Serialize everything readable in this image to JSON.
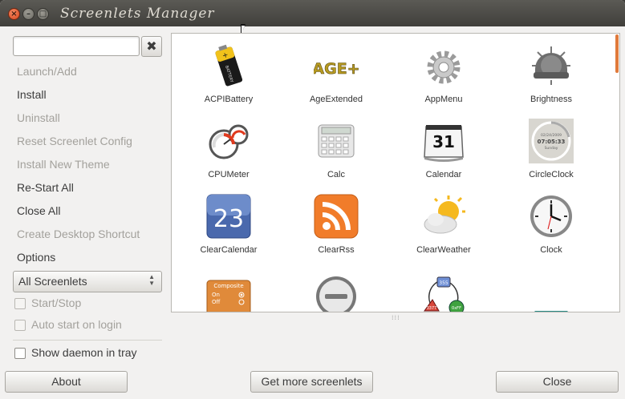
{
  "window": {
    "title": "Screenlets Manager",
    "close_glyph": "×",
    "minimize_glyph": "–",
    "maximize_glyph": "□"
  },
  "search": {
    "value": "",
    "clear_glyph": "✖"
  },
  "sidebar": {
    "items": [
      {
        "label": "Launch/Add",
        "enabled": false
      },
      {
        "label": "Install",
        "enabled": true
      },
      {
        "label": "Uninstall",
        "enabled": false
      },
      {
        "label": "Reset Screenlet Config",
        "enabled": false
      },
      {
        "label": "Install New Theme",
        "enabled": false
      },
      {
        "label": "Re-Start All",
        "enabled": true
      },
      {
        "label": "Close All",
        "enabled": true
      },
      {
        "label": "Create Desktop Shortcut",
        "enabled": false
      },
      {
        "label": "Options",
        "enabled": true
      }
    ],
    "filter": {
      "selected": "All Screenlets"
    },
    "checkboxes": [
      {
        "label": "Start/Stop",
        "checked": false,
        "enabled": false
      },
      {
        "label": "Auto start on login",
        "checked": false,
        "enabled": false
      },
      {
        "label": "Show daemon in tray",
        "checked": false,
        "enabled": true
      }
    ]
  },
  "screenlets": [
    {
      "label": "ACPIBattery",
      "icon": "battery-icon"
    },
    {
      "label": "AgeExtended",
      "icon": "age-plus-icon"
    },
    {
      "label": "AppMenu",
      "icon": "gear-icon"
    },
    {
      "label": "Brightness",
      "icon": "sun-dial-icon"
    },
    {
      "label": "CPUMeter",
      "icon": "gauge-icon"
    },
    {
      "label": "Calc",
      "icon": "calculator-icon"
    },
    {
      "label": "Calendar",
      "icon": "calendar-icon"
    },
    {
      "label": "CircleClock",
      "icon": "circle-clock-icon"
    },
    {
      "label": "ClearCalendar",
      "icon": "clear-calendar-icon"
    },
    {
      "label": "ClearRss",
      "icon": "rss-icon"
    },
    {
      "label": "ClearWeather",
      "icon": "weather-icon"
    },
    {
      "label": "Clock",
      "icon": "clock-icon"
    },
    {
      "label": "",
      "icon": "composite-toggle-icon"
    },
    {
      "label": "",
      "icon": "stop-icon"
    },
    {
      "label": "",
      "icon": "cycle-diagram-icon"
    },
    {
      "label": "",
      "icon": "teal-shape-icon"
    }
  ],
  "icon_text": {
    "age": "AGE+",
    "calendar_day": "31",
    "circle_clock_date": "02/24/2009",
    "circle_clock_time": "07:05:33",
    "circle_clock_day": "Sunday",
    "clear_calendar_day": "23",
    "composite_title": "Composite",
    "composite_on": "On",
    "composite_off": "Off",
    "cycle_top": "355",
    "cycle_left": "3377",
    "cycle_right": "0xFF"
  },
  "buttons": {
    "about": "About",
    "get_more": "Get more screenlets",
    "close": "Close"
  },
  "colors": {
    "accent": "#e07a3b",
    "titlebar": "#403f3b",
    "window_bg": "#f2f1f0"
  }
}
